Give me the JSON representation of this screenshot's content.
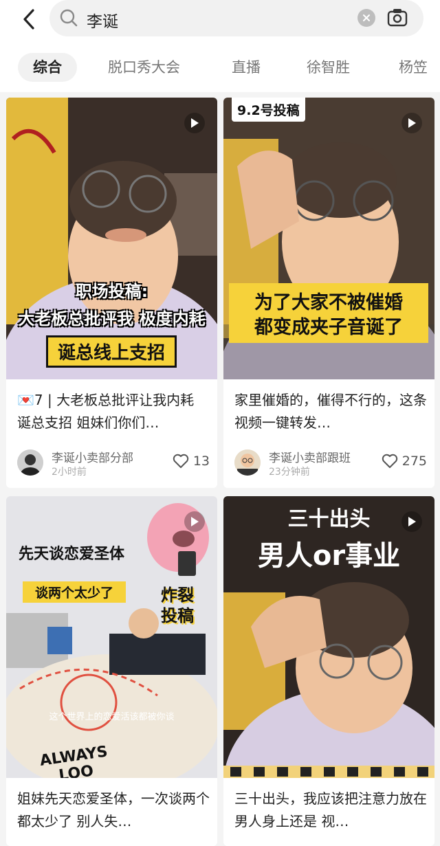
{
  "search": {
    "query": "李诞"
  },
  "tabs": [
    {
      "label": "综合",
      "active": true
    },
    {
      "label": "脱口秀大会"
    },
    {
      "label": "直播"
    },
    {
      "label": "徐智胜"
    },
    {
      "label": "杨笠"
    }
  ],
  "cards": [
    {
      "overlay": [
        "职场投稿:",
        "大老板总批评我 极度内耗",
        "诞总线上支招"
      ],
      "title": "💌7 | 大老板总批评让我内耗 诞总支招 姐妹们你们…",
      "author": "李诞小卖部分部",
      "time": "2小时前",
      "likes": "13"
    },
    {
      "badge": "9.2号投稿",
      "overlay": [
        "为了大家不被催婚",
        "都变成夹子音诞了"
      ],
      "title": "家里催婚的，催得不行的，这条视频一键转发…",
      "author": "李诞小卖部跟班",
      "time": "23分钟前",
      "likes": "275"
    },
    {
      "overlay": [
        "先天谈恋爱圣体",
        "谈两个太少了",
        "炸裂",
        "投稿",
        "这个世界上的恋爱活该都被你谈",
        "ALWAYS LOO"
      ],
      "title": "姐妹先天恋爱圣体，一次谈两个都太少了 别人失…"
    },
    {
      "overlay": [
        "三十出头",
        "男人or事业"
      ],
      "title": "三十出头，我应该把注意力放在男人身上还是 视…"
    }
  ],
  "colors": {
    "accent_yellow": "#f6d23a",
    "text": "#222222",
    "muted": "#888888"
  }
}
